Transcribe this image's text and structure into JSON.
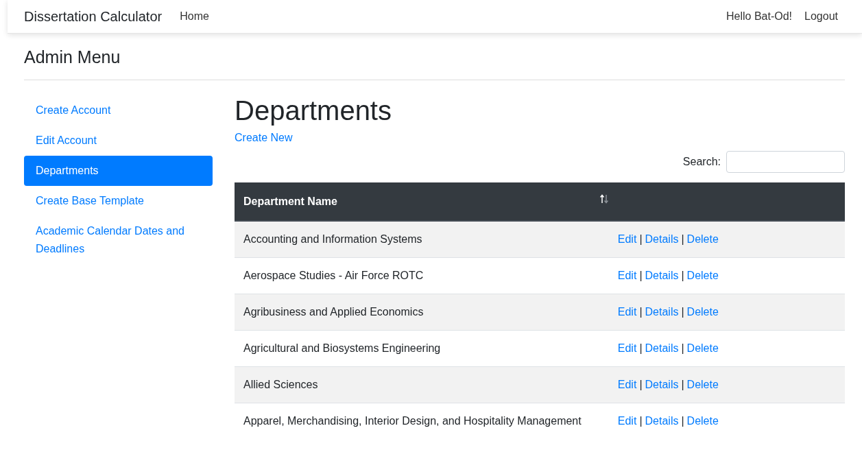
{
  "navbar": {
    "brand": "Dissertation Calculator",
    "links": [
      {
        "label": "Home"
      }
    ],
    "greeting": "Hello Bat-Od!",
    "logout": "Logout"
  },
  "admin_menu": {
    "title": "Admin Menu",
    "items": [
      {
        "label": "Create Account",
        "selected": false
      },
      {
        "label": "Edit Account",
        "selected": false
      },
      {
        "label": "Departments",
        "selected": true
      },
      {
        "label": "Create Base Template",
        "selected": false
      },
      {
        "label": "Academic Calendar Dates and Deadlines",
        "selected": false
      }
    ]
  },
  "page": {
    "title": "Departments",
    "create_link": "Create New",
    "search": {
      "label": "Search:"
    }
  },
  "table": {
    "columns": [
      {
        "label": "Department Name"
      }
    ],
    "rows": [
      {
        "name": "Accounting and Information Systems",
        "actions": [
          {
            "kind": "link",
            "label": "Edit"
          },
          {
            "kind": "separator",
            "label": "|"
          },
          {
            "kind": "link",
            "label": "Details"
          },
          {
            "kind": "separator",
            "label": "|"
          },
          {
            "kind": "link",
            "label": "Delete"
          }
        ]
      },
      {
        "name": "Aerospace Studies - Air Force ROTC",
        "actions": [
          {
            "kind": "link",
            "label": "Edit"
          },
          {
            "kind": "separator",
            "label": "|"
          },
          {
            "kind": "link",
            "label": "Details"
          },
          {
            "kind": "separator",
            "label": "|"
          },
          {
            "kind": "link",
            "label": "Delete"
          }
        ]
      },
      {
        "name": "Agribusiness and Applied Economics",
        "actions": [
          {
            "kind": "link",
            "label": "Edit"
          },
          {
            "kind": "separator",
            "label": "|"
          },
          {
            "kind": "link",
            "label": "Details"
          },
          {
            "kind": "separator",
            "label": "|"
          },
          {
            "kind": "link",
            "label": "Delete"
          }
        ]
      },
      {
        "name": "Agricultural and Biosystems Engineering",
        "actions": [
          {
            "kind": "link",
            "label": "Edit"
          },
          {
            "kind": "separator",
            "label": "|"
          },
          {
            "kind": "link",
            "label": "Details"
          },
          {
            "kind": "separator",
            "label": "|"
          },
          {
            "kind": "link",
            "label": "Delete"
          }
        ]
      },
      {
        "name": "Allied Sciences",
        "actions": [
          {
            "kind": "link",
            "label": "Edit"
          },
          {
            "kind": "separator",
            "label": "|"
          },
          {
            "kind": "link",
            "label": "Details"
          },
          {
            "kind": "separator",
            "label": "|"
          },
          {
            "kind": "link",
            "label": "Delete"
          }
        ]
      },
      {
        "name": "Apparel, Merchandising, Interior Design, and Hospitality Management",
        "actions": [
          {
            "kind": "link",
            "label": "Edit"
          },
          {
            "kind": "separator",
            "label": "|"
          },
          {
            "kind": "link",
            "label": "Details"
          },
          {
            "kind": "separator",
            "label": "|"
          },
          {
            "kind": "link",
            "label": "Delete"
          }
        ]
      }
    ]
  }
}
